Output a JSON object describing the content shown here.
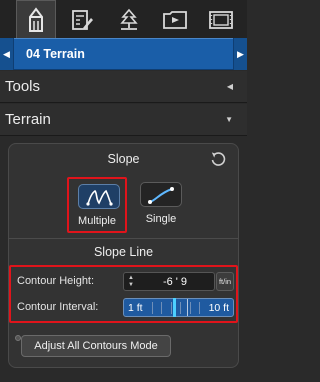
{
  "tabs": [
    {
      "icon": "pencil-icon",
      "active": true
    },
    {
      "icon": "layout-icon",
      "active": false
    },
    {
      "icon": "tree-icon",
      "active": false
    },
    {
      "icon": "video-icon",
      "active": false
    },
    {
      "icon": "film-icon",
      "active": false
    }
  ],
  "selector": {
    "title": "04 Terrain"
  },
  "sections": {
    "tools": "Tools",
    "terrain": "Terrain"
  },
  "slope": {
    "title": "Slope",
    "reset_icon": "reset-icon",
    "modes": [
      {
        "label": "Multiple",
        "icon": "multiple-contours-icon",
        "selected": true
      },
      {
        "label": "Single",
        "icon": "single-line-icon",
        "selected": false
      }
    ]
  },
  "slope_line": {
    "title": "Slope Line",
    "contour_height": {
      "label": "Contour Height:",
      "value": "-6 ' 9",
      "unit": "ft/in"
    },
    "contour_interval": {
      "label": "Contour Interval:",
      "min_label": "1 ft",
      "max_label": "10 ft",
      "position": 0.45
    },
    "adjust_button": "Adjust All Contours Mode"
  },
  "colors": {
    "accent_blue": "#1a5ea8",
    "highlight_red": "#e0141b",
    "slider_thumb": "#4dd0ff"
  }
}
